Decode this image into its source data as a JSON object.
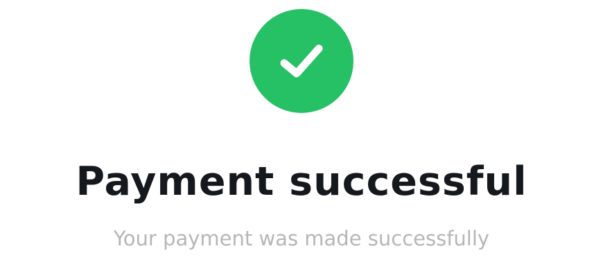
{
  "badge": {
    "icon": "checkmark-icon",
    "color": "#26c165",
    "icon_color": "#ffffff"
  },
  "title": "Payment successful",
  "subtitle": "Your payment was made successfully"
}
